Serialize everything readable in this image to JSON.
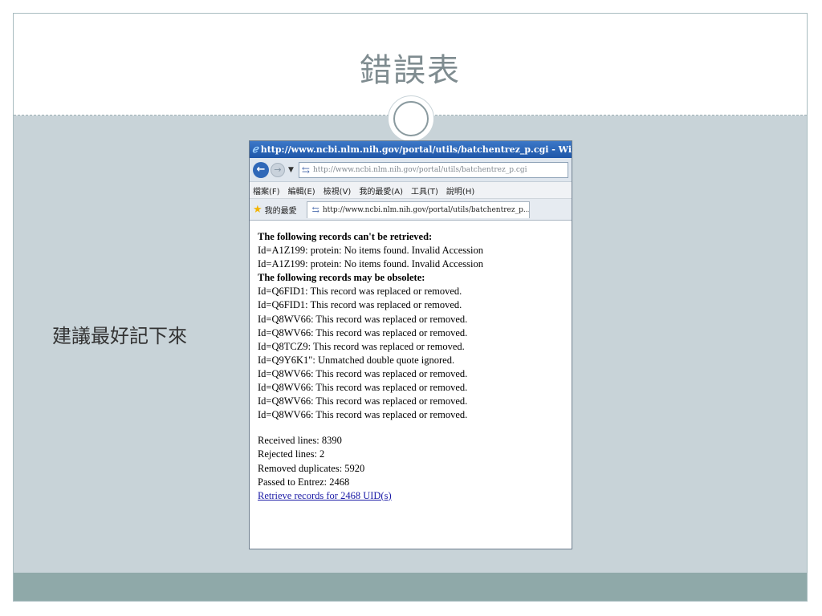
{
  "slide": {
    "title": "錯誤表",
    "bullet": "建議最好記下來"
  },
  "browser": {
    "window_title": "http://www.ncbi.nlm.nih.gov/portal/utils/batchentrez_p.cgi - Windows",
    "address": "http://www.ncbi.nlm.nih.gov/portal/utils/batchentrez_p.cgi",
    "menu": [
      "檔案(F)",
      "編輯(E)",
      "檢視(V)",
      "我的最愛(A)",
      "工具(T)",
      "說明(H)"
    ],
    "favorites_label": "我的最愛",
    "tab_title": "http://www.ncbi.nlm.nih.gov/portal/utils/batchentrez_p...."
  },
  "page": {
    "heading1": "The following records can't be retrieved:",
    "errors": [
      "Id=A1Z199: protein: No items found. Invalid Accession",
      "Id=A1Z199: protein: No items found. Invalid Accession"
    ],
    "heading2": "The following records may be obsolete:",
    "obsolete": [
      "Id=Q6FID1: This record was replaced or removed.",
      "Id=Q6FID1: This record was replaced or removed.",
      "Id=Q8WV66: This record was replaced or removed.",
      "Id=Q8WV66: This record was replaced or removed.",
      "Id=Q8TCZ9: This record was replaced or removed.",
      "Id=Q9Y6K1\": Unmatched double quote ignored.",
      "Id=Q8WV66: This record was replaced or removed.",
      "Id=Q8WV66: This record was replaced or removed.",
      "Id=Q8WV66: This record was replaced or removed.",
      "Id=Q8WV66: This record was replaced or removed."
    ],
    "stats": [
      "Received lines: 8390",
      "Rejected lines: 2",
      "Removed duplicates: 5920",
      "Passed to Entrez: 2468"
    ],
    "link": "Retrieve records for 2468 UID(s)"
  },
  "colors": {
    "content_bg": "#c8d3d8",
    "bottom_band": "#8fa9a9",
    "title_text": "#7f8c90",
    "link": "#1a1aa6"
  },
  "icons": [
    "ie-logo-icon",
    "back-arrow-icon",
    "forward-arrow-icon",
    "dropdown-arrow-icon",
    "page-icon",
    "star-icon"
  ]
}
